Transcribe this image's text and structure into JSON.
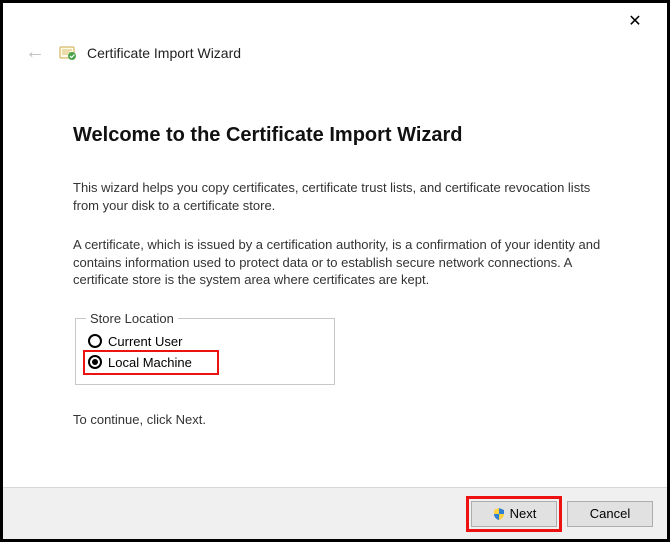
{
  "window": {
    "close_glyph": "✕"
  },
  "header": {
    "back_glyph": "←",
    "title": "Certificate Import Wizard"
  },
  "main": {
    "heading": "Welcome to the Certificate Import Wizard",
    "intro": "This wizard helps you copy certificates, certificate trust lists, and certificate revocation lists from your disk to a certificate store.",
    "explain": "A certificate, which is issued by a certification authority, is a confirmation of your identity and contains information used to protect data or to establish secure network connections. A certificate store is the system area where certificates are kept.",
    "store_legend": "Store Location",
    "radios": {
      "current_user": {
        "label": "Current User",
        "checked": false
      },
      "local_machine": {
        "label": "Local Machine",
        "checked": true
      }
    },
    "continue_hint": "To continue, click Next."
  },
  "footer": {
    "next_label": "Next",
    "cancel_label": "Cancel"
  }
}
